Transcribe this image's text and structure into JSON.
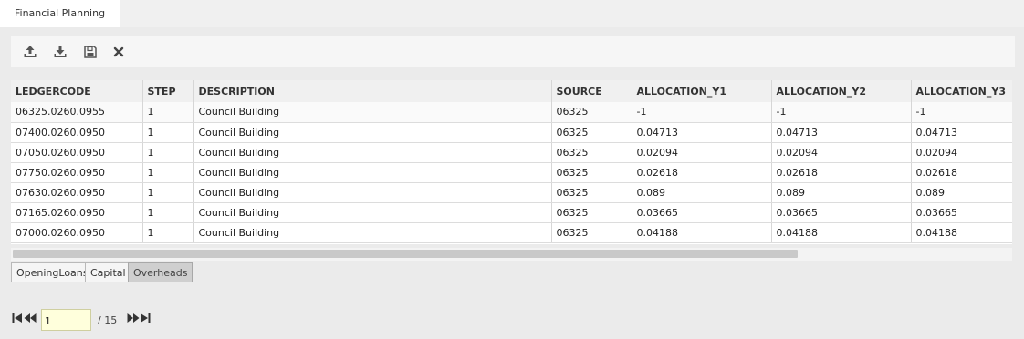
{
  "window": {
    "tab_title": "Financial Planning"
  },
  "toolbar": {
    "buttons": [
      {
        "icon": "upload-icon"
      },
      {
        "icon": "download-icon"
      },
      {
        "icon": "save-icon"
      },
      {
        "icon": "close-icon"
      }
    ]
  },
  "grid": {
    "columns": [
      "LEDGERCODE",
      "STEP",
      "DESCRIPTION",
      "SOURCE",
      "ALLOCATION_Y1",
      "ALLOCATION_Y2",
      "ALLOCATION_Y3"
    ],
    "rows": [
      [
        "06325.0260.0955",
        "1",
        "Council Building",
        "06325",
        "-1",
        "-1",
        "-1"
      ],
      [
        "07400.0260.0950",
        "1",
        "Council Building",
        "06325",
        "0.04713",
        "0.04713",
        "0.04713"
      ],
      [
        "07050.0260.0950",
        "1",
        "Council Building",
        "06325",
        "0.02094",
        "0.02094",
        "0.02094"
      ],
      [
        "07750.0260.0950",
        "1",
        "Council Building",
        "06325",
        "0.02618",
        "0.02618",
        "0.02618"
      ],
      [
        "07630.0260.0950",
        "1",
        "Council Building",
        "06325",
        "0.089",
        "0.089",
        "0.089"
      ],
      [
        "07165.0260.0950",
        "1",
        "Council Building",
        "06325",
        "0.03665",
        "0.03665",
        "0.03665"
      ],
      [
        "07000.0260.0950",
        "1",
        "Council Building",
        "06325",
        "0.04188",
        "0.04188",
        "0.04188"
      ]
    ]
  },
  "sheet_tabs": [
    {
      "label": "OpeningLoans",
      "active": false
    },
    {
      "label": "Capital",
      "active": false
    },
    {
      "label": "Overheads",
      "active": true
    }
  ],
  "pager": {
    "current_page": "1",
    "total_label": "/ 15",
    "icons": [
      "first-page-icon",
      "previous-page-icon",
      "next-page-icon",
      "last-page-icon"
    ]
  }
}
